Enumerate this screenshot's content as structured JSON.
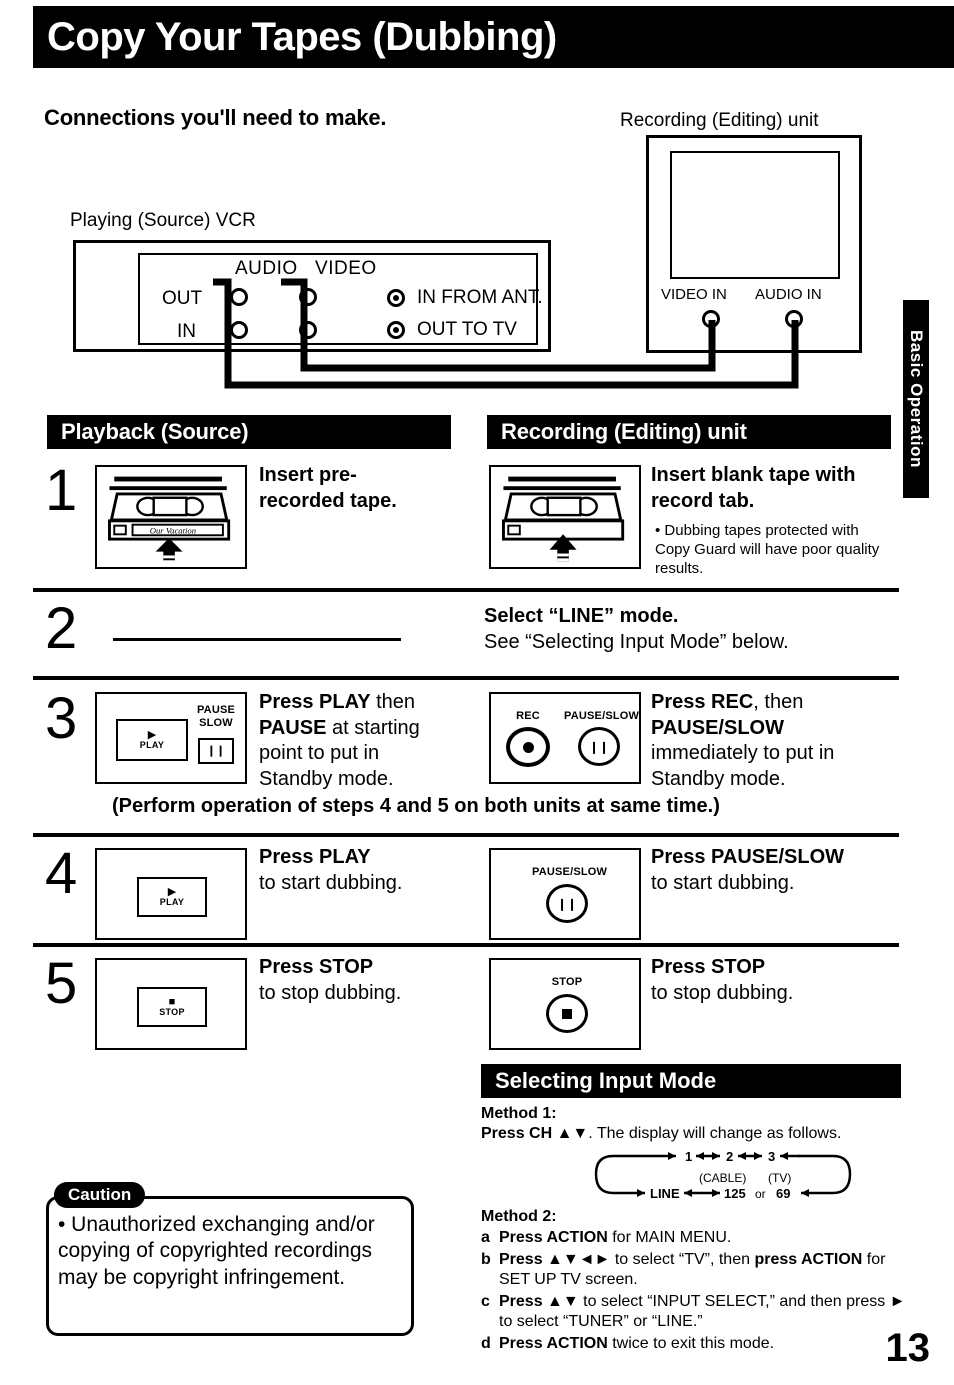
{
  "page": {
    "title": "Copy Your Tapes (Dubbing)",
    "number": "13",
    "side_tab": "Basic Operation"
  },
  "connections": {
    "heading": "Connections you'll need to make.",
    "source_label": "Playing (Source) VCR",
    "recording_label": "Recording (Editing) unit",
    "source_panel": {
      "audio_header": "AUDIO",
      "video_header": "VIDEO",
      "row_out": "OUT",
      "row_in": "IN",
      "ant_in": "IN FROM ANT.",
      "ant_out": "OUT TO TV"
    },
    "recording_panel": {
      "video_in": "VIDEO IN",
      "audio_in": "AUDIO IN"
    }
  },
  "columns": {
    "left_header": "Playback (Source)",
    "right_header": "Recording (Editing) unit"
  },
  "steps": [
    {
      "number": "1",
      "left": {
        "graphic": "cassette-insert",
        "text_bold": "Insert pre-",
        "text_bold2": "recorded tape."
      },
      "right": {
        "graphic": "cassette-insert",
        "text_bold": "Insert blank tape with",
        "text_bold2": "record tab.",
        "bullet": "• Dubbing tapes protected with Copy Guard will have poor quality results."
      }
    },
    {
      "number": "2",
      "left": {
        "graphic": "dash-line"
      },
      "right": {
        "text_bold": "Select “LINE” mode.",
        "text_normal": "See “Selecting Input Mode” below."
      }
    },
    {
      "number": "3",
      "left": {
        "graphic": "play-pause-panel",
        "buttons": {
          "play": "PLAY",
          "pause": "PAUSE",
          "slow": "SLOW"
        },
        "line1_bold": "Press PLAY",
        "line1_rest": " then",
        "line2_bold": "PAUSE",
        "line2_rest": " at starting",
        "line3": "point to put in",
        "line4": "Standby mode."
      },
      "right": {
        "graphic": "rec-pauseslow-panel",
        "buttons": {
          "rec": "REC",
          "pause_slow": "PAUSE/SLOW"
        },
        "line1_bold": "Press REC",
        "line1_rest": ", then",
        "line2_bold": "PAUSE/SLOW",
        "line3": "immediately to put in",
        "line4": "Standby mode."
      },
      "note": "(Perform operation of steps 4 and 5 on both units at same time.)"
    },
    {
      "number": "4",
      "left": {
        "graphic": "play-panel",
        "buttons": {
          "play": "PLAY"
        },
        "line1_bold": "Press PLAY",
        "line2": "to start dubbing."
      },
      "right": {
        "graphic": "pauseslow-round-panel",
        "buttons": {
          "pause_slow": "PAUSE/SLOW"
        },
        "line1_bold": "Press PAUSE/SLOW",
        "line2": "to start dubbing."
      }
    },
    {
      "number": "5",
      "left": {
        "graphic": "stop-panel",
        "buttons": {
          "stop": "STOP"
        },
        "line1_bold": "Press STOP",
        "line2": "to stop dubbing."
      },
      "right": {
        "graphic": "stop-round-panel",
        "buttons": {
          "stop": "STOP"
        },
        "line1_bold": "Press STOP",
        "line2": "to stop dubbing."
      }
    }
  ],
  "selecting_input_mode": {
    "header": "Selecting Input Mode",
    "method1_label": "Method 1:",
    "method1_text_bold": "Press CH ▲▼",
    "method1_text_rest": ". The display will change as follows.",
    "cycle": {
      "top": [
        "1",
        "2",
        "3"
      ],
      "bottom_line": "LINE",
      "bottom_cable_value": "125",
      "bottom_or": "or",
      "bottom_tv_value": "69",
      "cable_label": "(CABLE)",
      "tv_label": "(TV)"
    },
    "method2_label": "Method 2:",
    "method2_items": [
      {
        "letter": "a",
        "bold1": "Press ACTION",
        "rest1": " for MAIN MENU."
      },
      {
        "letter": "b",
        "bold1": "Press ▲▼◄►",
        "rest1": " to select “TV”, then ",
        "bold2": "press ACTION",
        "rest2": " for SET UP TV screen."
      },
      {
        "letter": "c",
        "bold1": "Press ▲▼",
        "rest1": " to select “INPUT SELECT,” and then press ► to select “TUNER” or “LINE.”"
      },
      {
        "letter": "d",
        "bold1": "Press ACTION",
        "rest1": " twice to exit this mode."
      }
    ]
  },
  "caution": {
    "label": "Caution",
    "text": "• Unauthorized exchanging and/or copying of copyrighted recordings may be copyright infringement."
  }
}
